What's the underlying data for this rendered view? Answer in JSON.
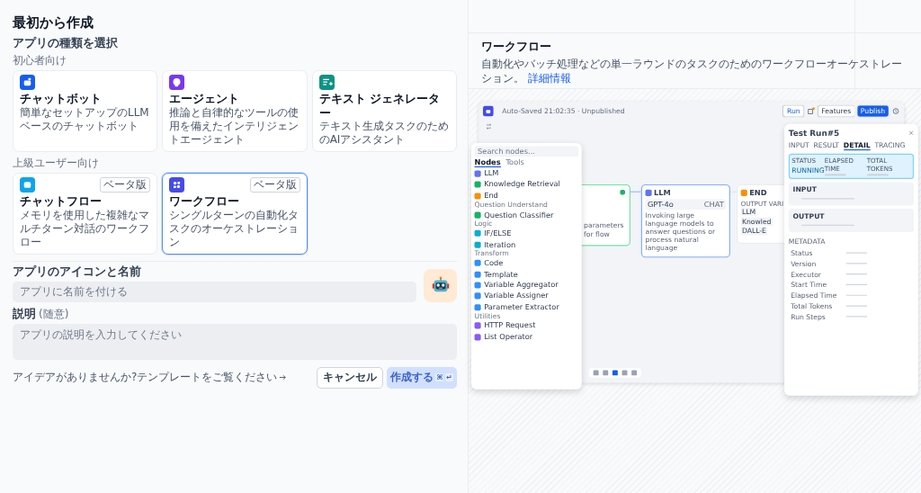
{
  "title": "最初から作成",
  "type_section": {
    "heading": "アプリの種類を選択",
    "groups": [
      {
        "label": "初心者向け",
        "apps": [
          {
            "kind": "chatbot",
            "color": "#155eef",
            "name": "チャットボット",
            "description": "簡単なセットアップのLLMベースのチャットボット",
            "selected": false
          },
          {
            "kind": "agent",
            "color": "#7839ee",
            "name": "エージェント",
            "description": "推論と自律的なツールの使用を備えたインテリジェントエージェント",
            "selected": false
          },
          {
            "kind": "text",
            "color": "#0e9384",
            "name": "テキスト ジェネレーター",
            "description": "テキスト生成タスクのためのAIアシスタント",
            "selected": false
          }
        ]
      },
      {
        "label": "上級ユーザー向け",
        "apps": [
          {
            "kind": "chatflow",
            "color": "#0ba5ec",
            "name": "チャットフロー",
            "description": "メモリを使用した複雑なマルチターン対話のワークフロー",
            "badge": "ベータ版",
            "selected": false
          },
          {
            "kind": "workflow",
            "color": "#444ce7",
            "name": "ワークフロー",
            "description": "シングルターンの自動化タスクのオーケストレーション",
            "badge": "ベータ版",
            "selected": true
          }
        ]
      }
    ]
  },
  "name_field": {
    "label": "アプリのアイコンと名前",
    "placeholder": "アプリに名前を付ける"
  },
  "description_field": {
    "label": "説明",
    "optional": "(随意)",
    "placeholder": "アプリの説明を入力してください"
  },
  "template_link": "アイデアがありませんか?テンプレートをご覧ください",
  "buttons": {
    "cancel": "キャンセル",
    "create": {
      "label": "作成する",
      "keys": [
        "⌘",
        "↵"
      ],
      "disabled": true
    }
  },
  "preview": {
    "title": "ワークフロー",
    "description": "自動化やバッチ処理などの単一ラウンドのタスクのためのワークフローオーケストレーション。",
    "link": "詳細情報",
    "screenshot": {
      "status": "Auto-Saved 21:02:35 · Unpublished",
      "run": "Run",
      "features": "Features",
      "publish": "Publish",
      "node_panel": {
        "search_placeholder": "Search nodes...",
        "tabs": [
          {
            "label": "Nodes",
            "selected": true
          },
          {
            "label": "Tools",
            "selected": false
          }
        ],
        "groups": [
          {
            "items": [
              {
                "name": "LLM",
                "color": "#6172f3"
              },
              {
                "name": "Knowledge Retrieval",
                "color": "#16b364"
              },
              {
                "name": "End",
                "color": "#f79009"
              }
            ]
          },
          {
            "label": "Question Understand",
            "items": [
              {
                "name": "Question Classifier",
                "color": "#16b364"
              }
            ]
          },
          {
            "label": "Logic",
            "items": [
              {
                "name": "IF/ELSE",
                "color": "#06aed4"
              },
              {
                "name": "Iteration",
                "color": "#06aed4"
              }
            ]
          },
          {
            "label": "Transform",
            "items": [
              {
                "name": "Code",
                "color": "#2e90fa"
              },
              {
                "name": "Template",
                "color": "#2e90fa"
              },
              {
                "name": "Variable Aggregator",
                "color": "#2e90fa"
              },
              {
                "name": "Variable Assigner",
                "color": "#2e90fa"
              },
              {
                "name": "Parameter Extractor",
                "color": "#2e90fa"
              }
            ]
          },
          {
            "label": "Utilities",
            "items": [
              {
                "name": "HTTP Request",
                "color": "#875bf7"
              },
              {
                "name": "List Operator",
                "color": "#875bf7"
              }
            ]
          }
        ]
      },
      "start_node": {
        "description": "parameters for flow"
      },
      "llm_node": {
        "title": "LLM",
        "model": "GPT-4o",
        "tag": "CHAT",
        "description": "Invoking large language models to answer questions or process natural language"
      },
      "end_node": {
        "title": "END",
        "outputs_label": "OUTPUT VARI",
        "outputs": [
          "LLM",
          "Knowled",
          "DALL-E"
        ]
      },
      "test_run": {
        "title": "Test Run#5",
        "tabs": [
          {
            "label": "INPUT",
            "selected": false
          },
          {
            "label": "RESULT",
            "selected": false
          },
          {
            "label": "DETAIL",
            "selected": true
          },
          {
            "label": "TRACING",
            "selected": false
          }
        ],
        "status_labels": [
          "STATUS",
          "ELAPSED TIME",
          "TOTAL TOKENS"
        ],
        "status": "RUNNING",
        "input_label": "INPUT",
        "output_label": "OUTPUT",
        "metadata_label": "METADATA",
        "metadata": [
          "Status",
          "Version",
          "Executor",
          "Start Time",
          "Elapsed Time",
          "Total Tokens",
          "Run Steps"
        ]
      }
    }
  }
}
